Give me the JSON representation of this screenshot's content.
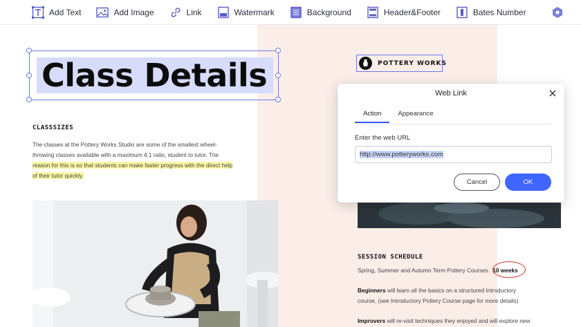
{
  "toolbar": {
    "items": [
      {
        "label": "Add Text",
        "icon": "text-icon"
      },
      {
        "label": "Add Image",
        "icon": "image-icon"
      },
      {
        "label": "Link",
        "icon": "link-icon"
      },
      {
        "label": "Watermark",
        "icon": "watermark-icon"
      },
      {
        "label": "Background",
        "icon": "background-icon"
      },
      {
        "label": "Header&Footer",
        "icon": "header-footer-icon"
      },
      {
        "label": "Bates Number",
        "icon": "bates-number-icon"
      }
    ],
    "extra_icon": "hexagon-settings-icon",
    "icon_color": "#5b5fc7"
  },
  "document": {
    "title": "Class Details",
    "classsizes_label": "CLASSSIZES",
    "classsizes_line1": "The classes at the Pottery Works Studio are some of the smallest wheel-",
    "classsizes_line2": "throwing classes available with a maximum 4:1 ratio, student to tutor. The",
    "classsizes_line3": "reason for this is so that students can make faster progress with the direct help",
    "classsizes_line4": "of their tutor quickly.",
    "logo_text": "POTTERY WORKS",
    "schedule_label": "SESSION SCHEDULE",
    "schedule_line": "Spring, Summer and Autumn Term Pottery Courses",
    "schedule_duration": "10 weeks",
    "beginners_bold": "Beginners",
    "beginners_line1": " will learn all the basics on a structured Introductory",
    "beginners_line2": "course, (see Introductory Pottery Course page for more details)",
    "improvers_bold": "Improvers",
    "improvers_line": " will re-visit techniques they enjoyed and will explore new",
    "highlight_color": "#fbf7a3",
    "title_highlight_color": "#d7dcfb",
    "panel_color": "#fbeee9"
  },
  "dialog": {
    "title": "Web Link",
    "tabs": [
      "Action",
      "Appearance"
    ],
    "active_tab": "Action",
    "field_label": "Enter the web URL",
    "url_value": "http://www.potteryworks.com",
    "cancel_label": "Cancel",
    "ok_label": "OK",
    "accent_color": "#3f66ff"
  }
}
